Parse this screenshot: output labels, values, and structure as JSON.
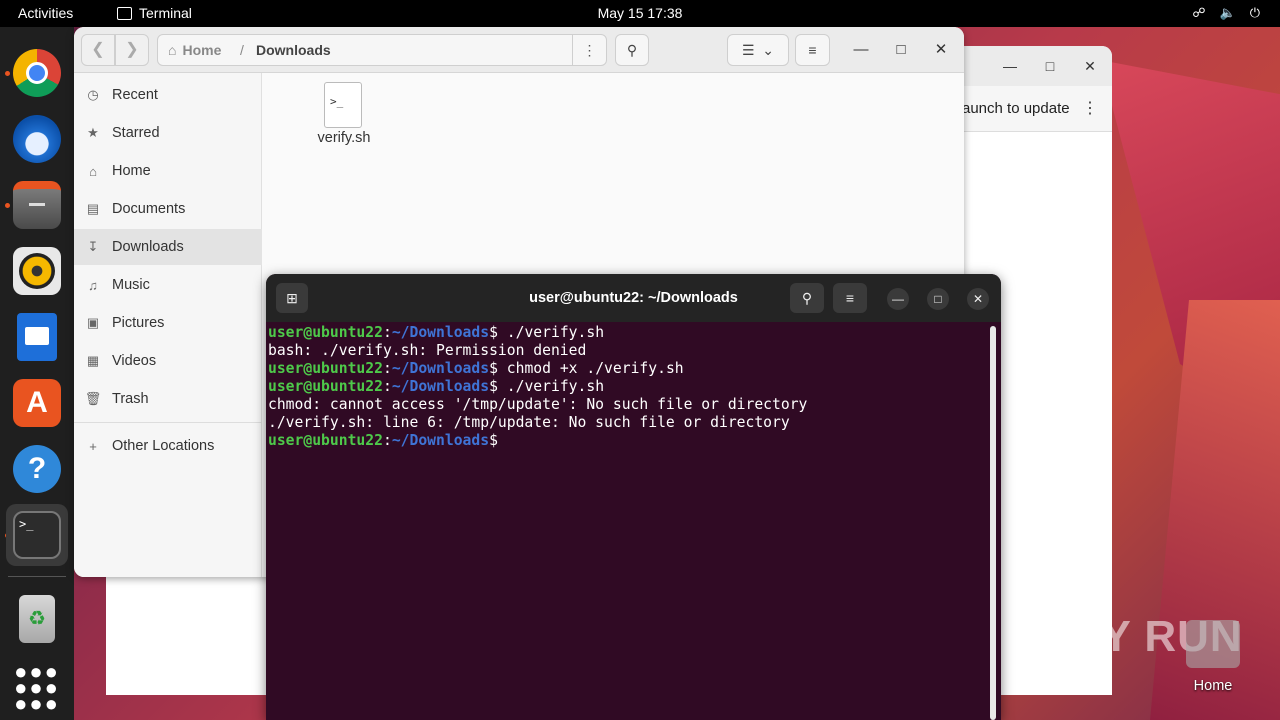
{
  "topbar": {
    "activities": "Activities",
    "app_name": "Terminal",
    "clock": "May 15  17:38",
    "tray": [
      "network-icon",
      "volume-icon",
      "power-icon"
    ]
  },
  "dock": {
    "items": [
      "chrome-icon",
      "thunderbird-icon",
      "files-icon",
      "rhythmbox-icon",
      "writer-icon",
      "app-center-icon",
      "help-icon",
      "terminal-icon",
      "trash-icon",
      "app-grid-icon"
    ]
  },
  "back_window": {
    "button_label": "aunch to update"
  },
  "files": {
    "path_home": "Home",
    "path_sep": "/",
    "path_current": "Downloads",
    "sidebar": [
      {
        "icon": "clock-icon",
        "label": "Recent"
      },
      {
        "icon": "star-icon",
        "label": "Starred"
      },
      {
        "icon": "home-icon",
        "label": "Home"
      },
      {
        "icon": "document-icon",
        "label": "Documents"
      },
      {
        "icon": "download-icon",
        "label": "Downloads"
      },
      {
        "icon": "music-icon",
        "label": "Music"
      },
      {
        "icon": "picture-icon",
        "label": "Pictures"
      },
      {
        "icon": "video-icon",
        "label": "Videos"
      },
      {
        "icon": "trash-icon",
        "label": "Trash"
      }
    ],
    "other_locations": "Other Locations",
    "file_glyph": ">_",
    "file_name": "verify.sh"
  },
  "terminal": {
    "title": "user@ubuntu22: ~/Downloads",
    "prompt_user": "user@ubuntu22",
    "prompt_colon": ":",
    "prompt_path": "~/Downloads",
    "prompt_end": "$ ",
    "lines": [
      {
        "type": "cmd",
        "text": "./verify.sh"
      },
      {
        "type": "out",
        "text": "bash: ./verify.sh: Permission denied"
      },
      {
        "type": "cmd",
        "text": "chmod +x ./verify.sh"
      },
      {
        "type": "cmd",
        "text": "./verify.sh"
      },
      {
        "type": "out",
        "text": "chmod: cannot access '/tmp/update': No such file or directory"
      },
      {
        "type": "out",
        "text": "./verify.sh: line 6: /tmp/update: No such file or directory"
      },
      {
        "type": "cmd",
        "text": ""
      }
    ]
  },
  "desktop": {
    "home_label": "Home",
    "watermark": "ANY RUN"
  }
}
